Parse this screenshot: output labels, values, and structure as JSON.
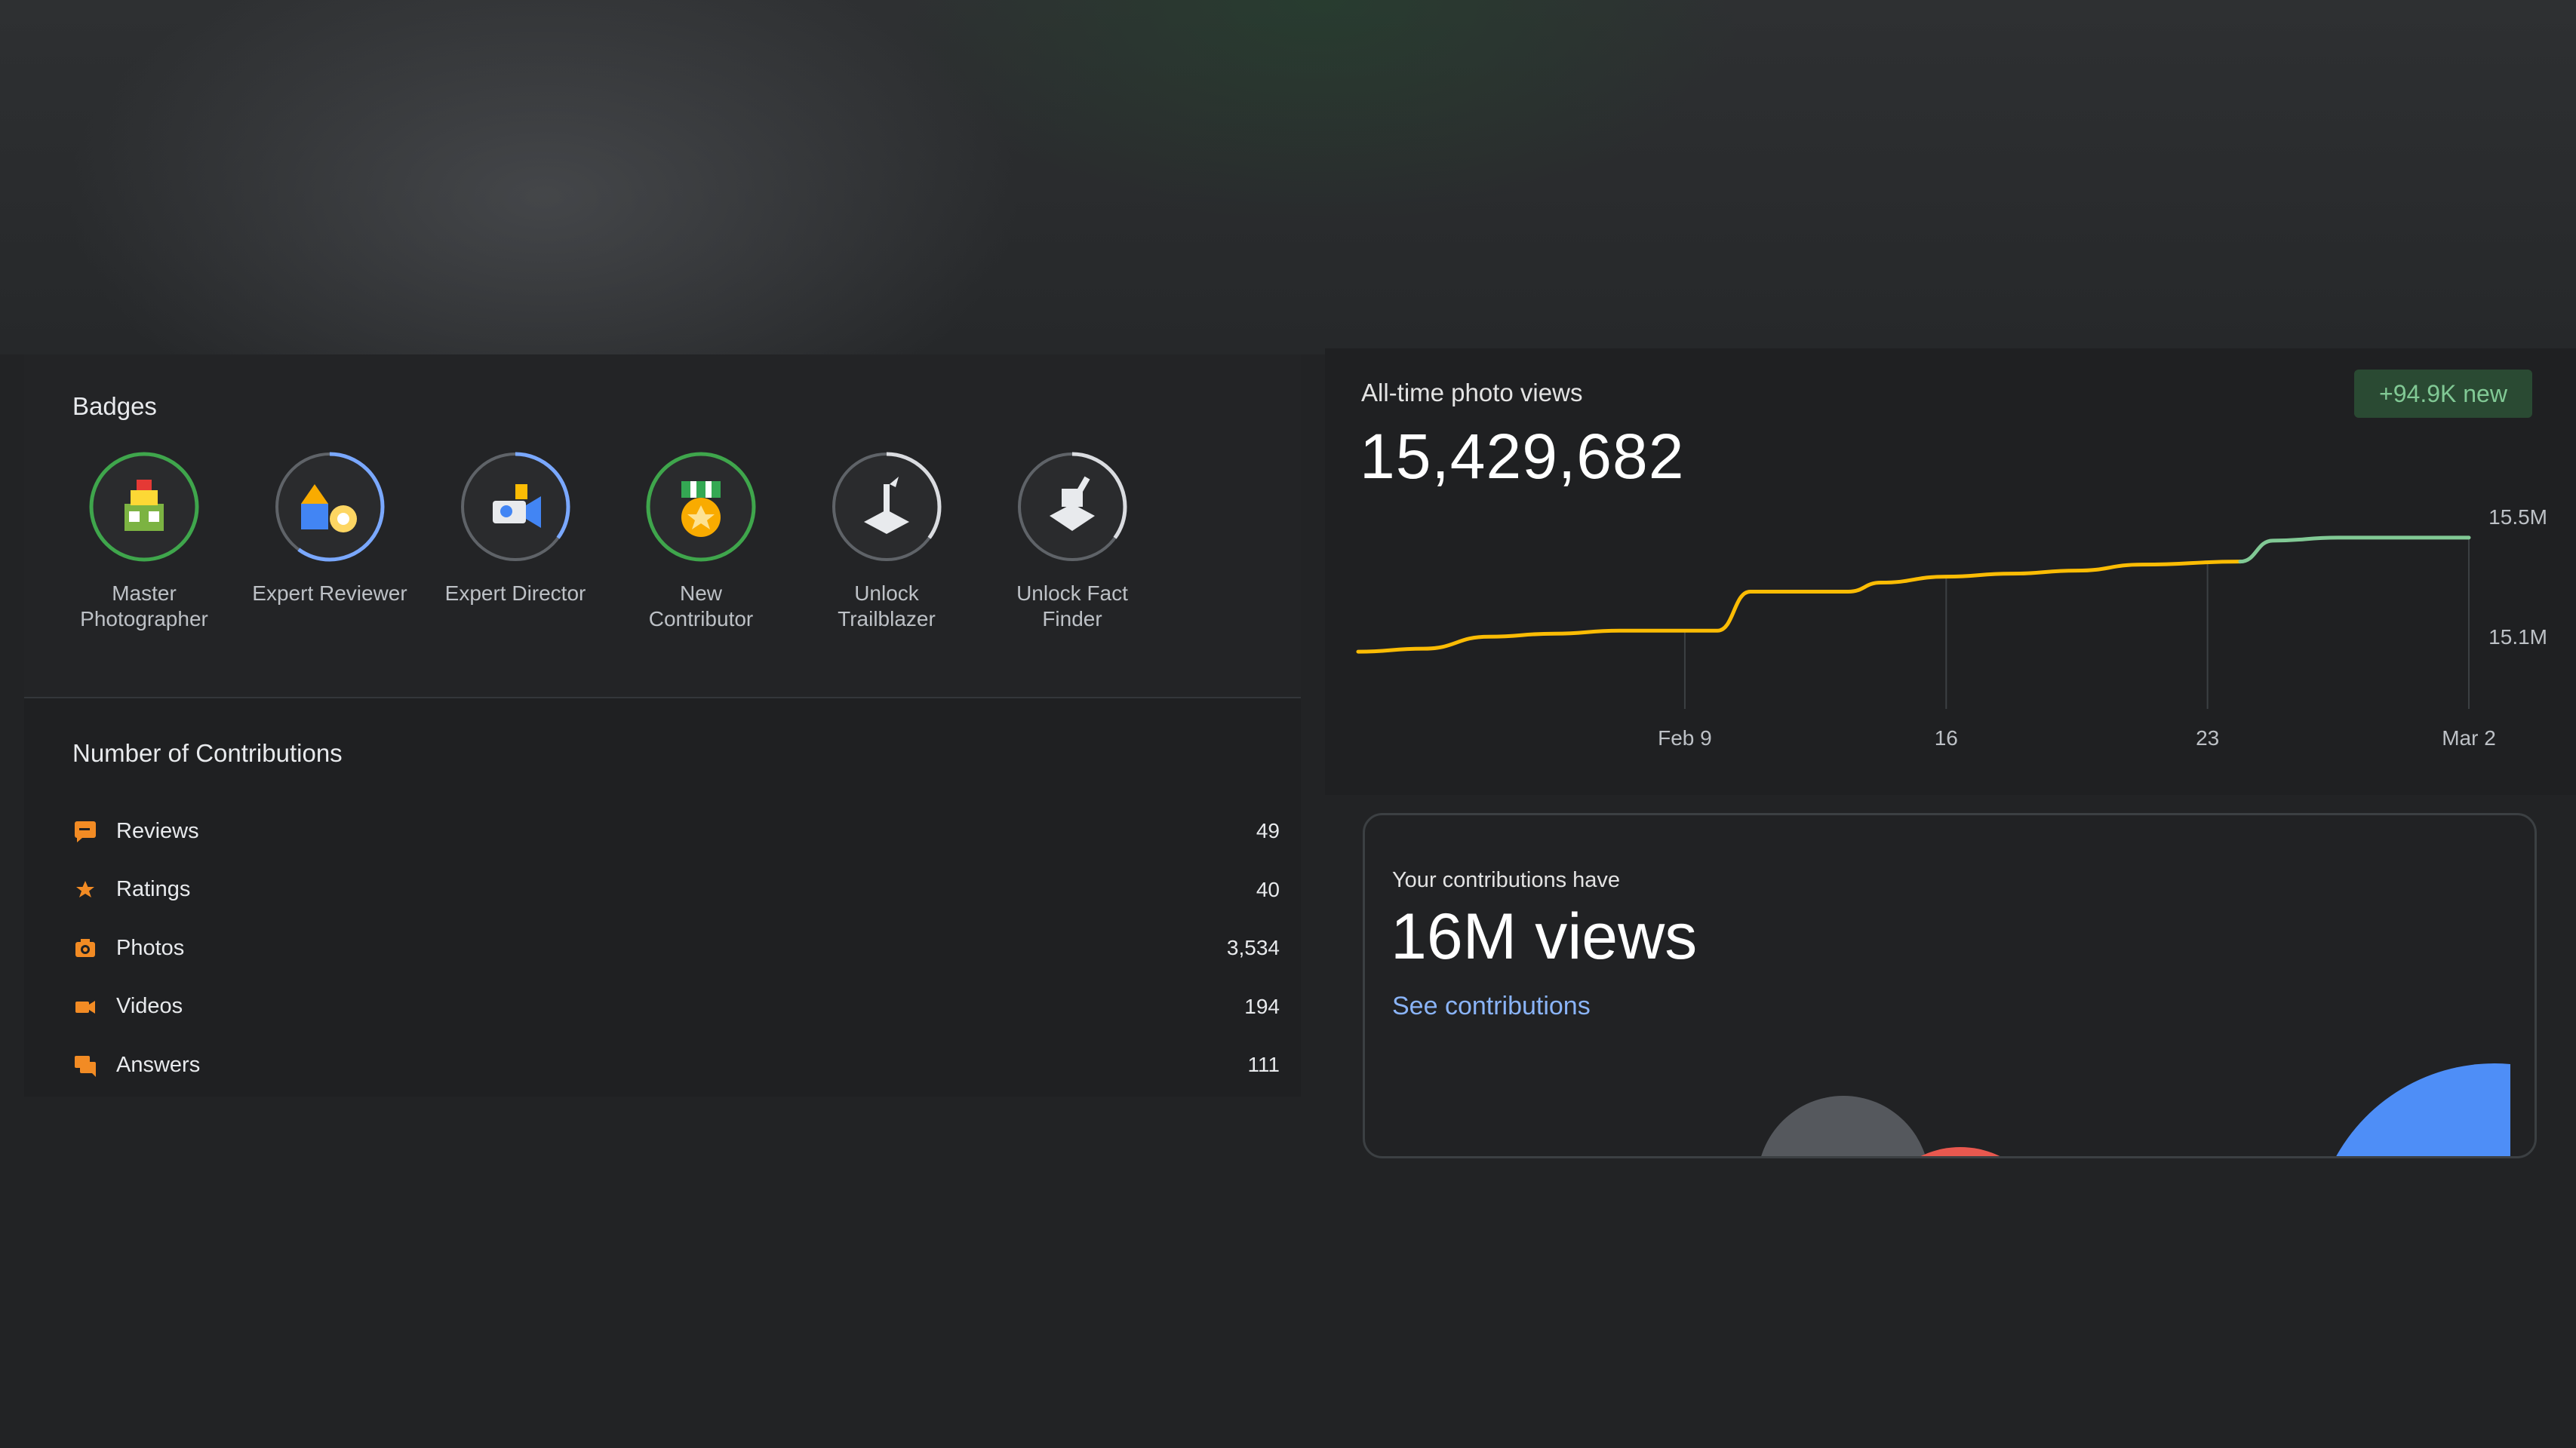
{
  "badges": {
    "title": "Badges",
    "items": [
      {
        "name": "master-photographer",
        "label_lines": [
          "Master",
          "Photographer"
        ],
        "ring": "#3fa64c",
        "progress": 1.0,
        "icon": "buildings-icon"
      },
      {
        "name": "expert-reviewer",
        "label_lines": [
          "Expert Reviewer",
          ""
        ],
        "ring": "#7aa8ff",
        "progress": 0.6,
        "icon": "pencil-review-icon"
      },
      {
        "name": "expert-director",
        "label_lines": [
          "Expert Director",
          ""
        ],
        "ring": "#7aa8ff",
        "progress": 0.35,
        "icon": "video-camera-icon"
      },
      {
        "name": "new-contributor",
        "label_lines": [
          "New",
          "Contributor"
        ],
        "ring": "#3fa64c",
        "progress": 1.0,
        "icon": "medal-icon"
      },
      {
        "name": "unlock-trailblazer",
        "label_lines": [
          "Unlock",
          "Trailblazer"
        ],
        "ring": "#dadce0",
        "progress": 0.35,
        "icon": "locked-trailblazer-icon"
      },
      {
        "name": "unlock-fact-finder",
        "label_lines": [
          "Unlock Fact",
          "Finder"
        ],
        "ring": "#dadce0",
        "progress": 0.35,
        "icon": "locked-fact-finder-icon"
      }
    ]
  },
  "contributions": {
    "title": "Number of Contributions",
    "accent": "#f28b24",
    "items": [
      {
        "label": "Reviews",
        "value": "49",
        "icon": "review-icon"
      },
      {
        "label": "Ratings",
        "value": "40",
        "icon": "star-icon"
      },
      {
        "label": "Photos",
        "value": "3,534",
        "icon": "camera-icon"
      },
      {
        "label": "Videos",
        "value": "194",
        "icon": "videocam-icon"
      },
      {
        "label": "Answers",
        "value": "111",
        "icon": "answers-icon"
      }
    ]
  },
  "photo_views": {
    "label": "All-time photo views",
    "total": "15,429,682",
    "new_badge": "+94.9K new",
    "colors": {
      "old": "#fbbc04",
      "new": "#81c995"
    }
  },
  "chart_data": {
    "type": "line",
    "x_ticks": [
      "Feb 9",
      "16",
      "23",
      "Mar 2"
    ],
    "y_ticks": [
      "15.5M",
      "15.1M"
    ],
    "ylim": [
      15.1,
      15.5
    ],
    "x": [
      0,
      2,
      4,
      6,
      8,
      10,
      11,
      12,
      14,
      15,
      16,
      18,
      20,
      22,
      24,
      27,
      28,
      30,
      32,
      34
    ],
    "values": [
      15.05,
      15.06,
      15.1,
      15.11,
      15.12,
      15.12,
      15.12,
      15.25,
      15.25,
      15.25,
      15.28,
      15.3,
      15.31,
      15.32,
      15.34,
      15.35,
      15.42,
      15.43,
      15.43,
      15.43
    ],
    "split_index": 15
  },
  "summary_card": {
    "subtitle": "Your contributions have",
    "headline": "16M views",
    "link": "See contributions"
  }
}
